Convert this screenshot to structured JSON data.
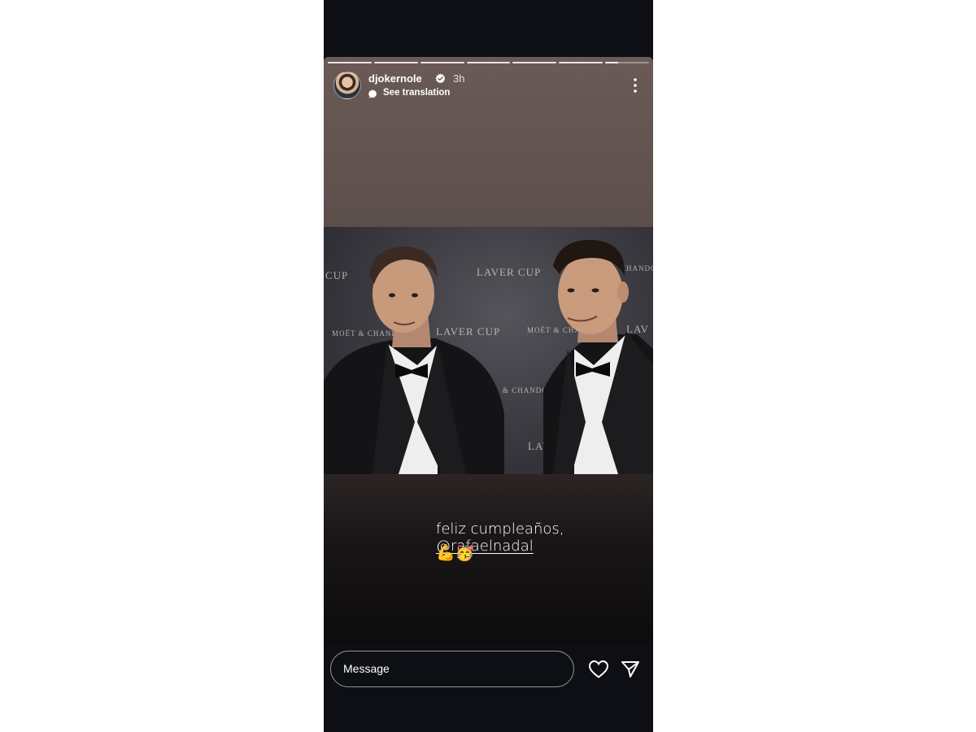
{
  "story": {
    "username": "djokernole",
    "time": "3h",
    "see_translation": "See translation",
    "progress_segments": 7,
    "photo_backdrop": [
      "CUP",
      "LAVER CUP",
      "LAVER CUP",
      "MOËT & CHANDON",
      "MOËT & CHANDON",
      "LAV",
      "& CHANDON",
      "LAV",
      "CHANDON"
    ],
    "caption_text": "feliz cumpleaños, ",
    "caption_mention": "@rafaelnadal",
    "caption_emojis": "💪🥳"
  },
  "reply": {
    "placeholder": "Message"
  },
  "icons": {
    "verified": "verified-badge-icon",
    "translate": "speech-bubble-icon",
    "more": "more-vertical-icon",
    "like": "heart-icon",
    "share": "send-icon"
  }
}
